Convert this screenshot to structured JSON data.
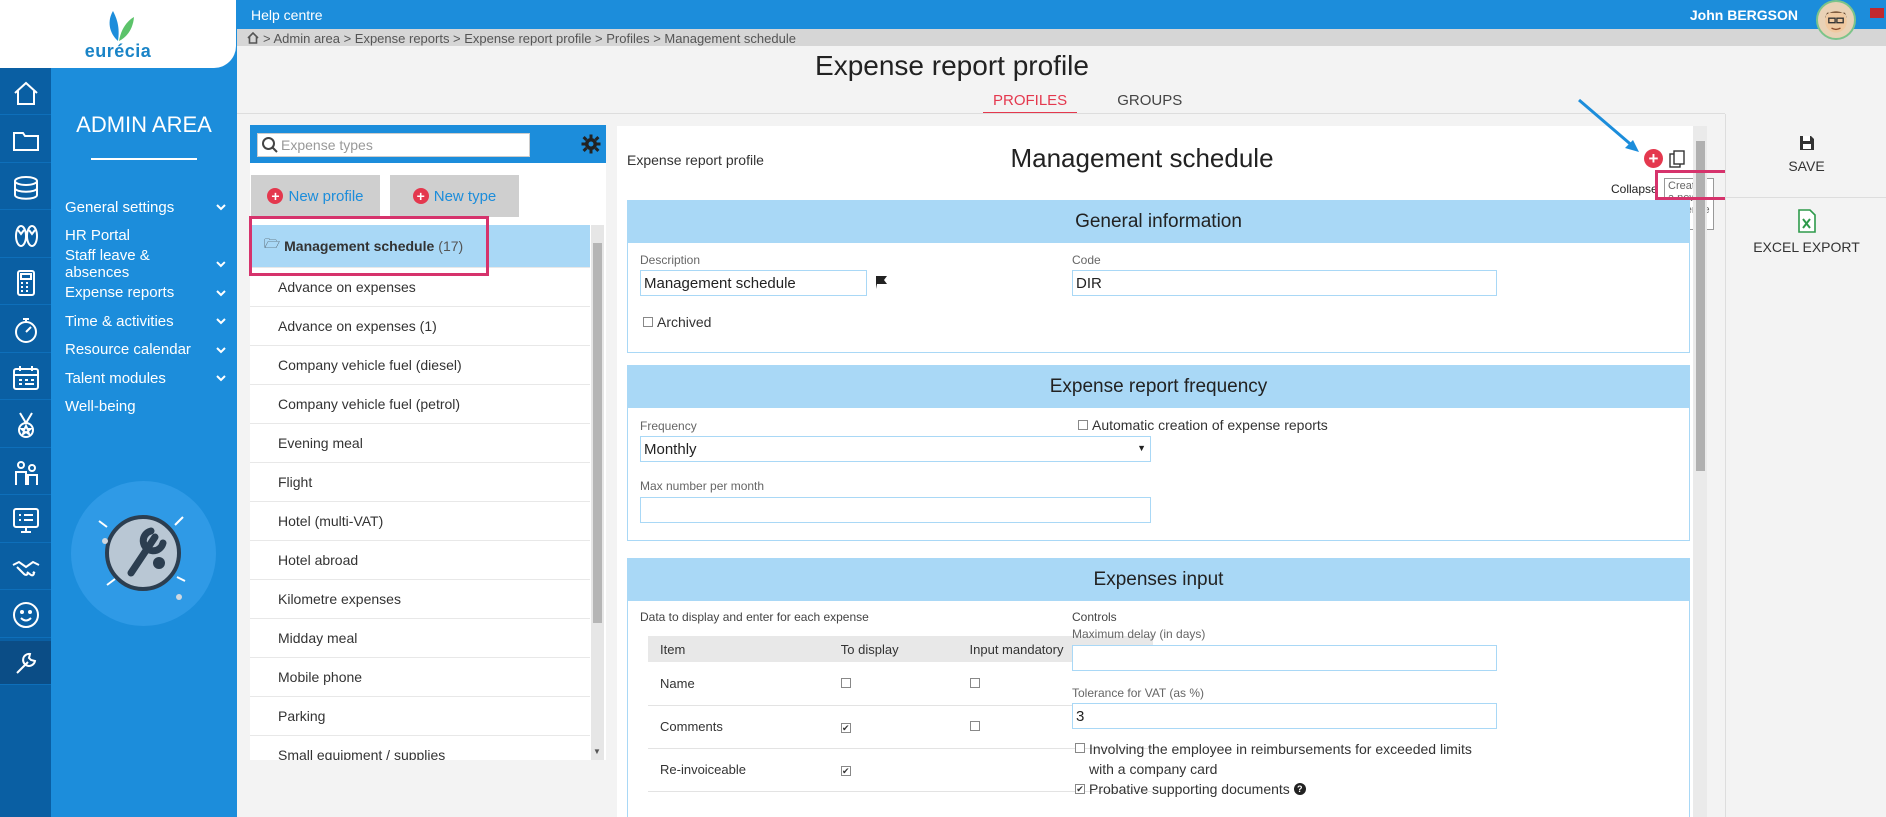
{
  "app": {
    "logo_text": "eurécia",
    "admin_title": "ADMIN AREA"
  },
  "topbar": {
    "help": "Help centre",
    "user": "John  BERGSON"
  },
  "breadcrumb": ">  Admin area > Expense reports > Expense report profile >  Profiles  > Management schedule",
  "page": {
    "title": "Expense report profile"
  },
  "tabs": [
    {
      "label": "PROFILES",
      "active": true
    },
    {
      "label": "GROUPS",
      "active": false
    }
  ],
  "rail_icons": [
    "home-icon",
    "folder-icon",
    "coins-icon",
    "sandals-icon",
    "calculator-icon",
    "stopwatch-icon",
    "calendar-icon",
    "medal-icon",
    "people-icon",
    "checklist-board-icon",
    "handshake-icon",
    "smiley-icon",
    "wrench-icon"
  ],
  "admin_menu": [
    {
      "label": "General settings",
      "chevron": true
    },
    {
      "label": "HR Portal",
      "chevron": false
    },
    {
      "label": "Staff leave & absences",
      "chevron": true
    },
    {
      "label": "Expense reports",
      "chevron": true
    },
    {
      "label": "Time & activities",
      "chevron": true
    },
    {
      "label": "Resource calendar",
      "chevron": true
    },
    {
      "label": "Talent modules",
      "chevron": true
    },
    {
      "label": "Well-being",
      "chevron": false
    }
  ],
  "left": {
    "search_placeholder": "Expense types",
    "new_profile": "New profile",
    "new_type": "New type",
    "selected": {
      "name": "Management schedule",
      "count": "(17)"
    },
    "items": [
      "Advance on expenses",
      "Advance on expenses (1)",
      "Company vehicle fuel (diesel)",
      "Company vehicle fuel (petrol)",
      "Evening meal",
      "Flight",
      "Hotel (multi-VAT)",
      "Hotel abroad",
      "Kilometre expenses",
      "Midday meal",
      "Mobile phone",
      "Parking",
      "Small equipment / supplies"
    ]
  },
  "detail": {
    "label": "Expense report profile",
    "title": "Management schedule",
    "collapse": "Collapse",
    "tooltip": "Create a new expense type",
    "general": {
      "heading": "General information",
      "description_label": "Description",
      "description_value": "Management schedule",
      "code_label": "Code",
      "code_value": "DIR",
      "archived_label": "Archived"
    },
    "frequency": {
      "heading": "Expense report frequency",
      "frequency_label": "Frequency",
      "frequency_value": "Monthly",
      "auto_label": "Automatic creation of expense reports",
      "max_label": "Max number per month",
      "max_value": ""
    },
    "expenses": {
      "heading": "Expenses input",
      "data_label": "Data to display and enter for each expense",
      "cols": [
        "Item",
        "To display",
        "Input mandatory"
      ],
      "rows": [
        {
          "item": "Name",
          "display": false,
          "mandatory": false
        },
        {
          "item": "Comments",
          "display": true,
          "mandatory": false
        },
        {
          "item": "Re-invoiceable",
          "display": true,
          "mandatory": null
        }
      ],
      "controls_label": "Controls",
      "delay_label": "Maximum delay (in days)",
      "delay_value": "",
      "vat_label": "Tolerance for VAT (as %)",
      "vat_value": "3",
      "involving_label": "Involving the employee in reimbursements for exceeded limits with a company card",
      "probative_label": "Probative supporting documents"
    }
  },
  "actions": {
    "save": "SAVE",
    "excel": "EXCEL EXPORT"
  }
}
